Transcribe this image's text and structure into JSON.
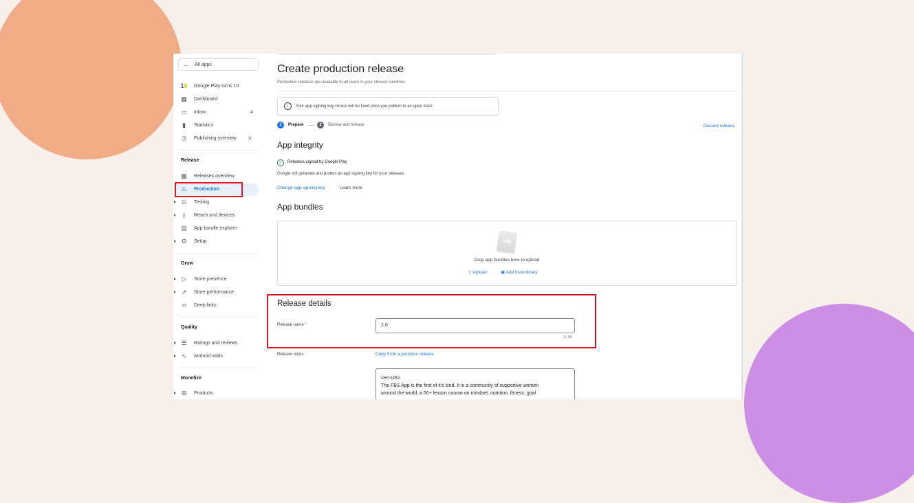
{
  "sidebar": {
    "all_apps": "All apps",
    "top_items": [
      {
        "label": "Google Play turns 10",
        "icon": "google-play-10-icon"
      },
      {
        "label": "Dashboard",
        "icon": "dashboard-icon"
      },
      {
        "label": "Inbox",
        "icon": "inbox-icon",
        "count": "4"
      },
      {
        "label": "Statistics",
        "icon": "statistics-icon"
      },
      {
        "label": "Publishing overview",
        "icon": "publishing-icon"
      }
    ],
    "sections": {
      "release": "Release",
      "grow": "Grow",
      "quality": "Quality",
      "monetize": "Monetize"
    },
    "release_items": [
      "Releases overview",
      "Production",
      "Testing",
      "Reach and devices",
      "App bundle explorer",
      "Setup"
    ],
    "grow_items": [
      "Store presence",
      "Store performance",
      "Deep links"
    ],
    "quality_items": [
      "Ratings and reviews",
      "Android vitals"
    ],
    "monetize_items": [
      "Products"
    ]
  },
  "main": {
    "title": "Create production release",
    "subtitle": "Production releases are available to all users in your chosen countries",
    "banner": "Your app signing key choice will be fixed once you publish to an open track",
    "steps": [
      {
        "num": "1",
        "label": "Prepare"
      },
      {
        "num": "2",
        "label": "Review and release"
      }
    ],
    "discard": "Discard release",
    "integrity": {
      "title": "App integrity",
      "signed": "Releases signed by Google Play",
      "desc": "Google will generate and protect an app signing key for your releases",
      "change_link": "Change app signing key",
      "learn_more": "Learn more"
    },
    "bundles": {
      "title": "App bundles",
      "aab": "AAB",
      "drop_text": "Drop app bundles here to upload",
      "upload": "Upload",
      "library": "Add from library"
    },
    "details": {
      "title": "Release details",
      "name_label": "Release name",
      "required": "*",
      "name_value": "1.0",
      "counter": "3 / 50",
      "notes_label": "Release notes",
      "copy_link": "Copy from a previous release",
      "notes_value": "<en-US>\nThe FBS App is the first of it's kind. It is a community of supportive women\naround the world, a 50+ lesson course on mindset, nutrition, fitness, goal"
    }
  },
  "colors": {
    "accent": "#1a73e8",
    "highlight_border": "#e3141b",
    "background": "#f7efe9",
    "blob_orange": "#f0ac86",
    "blob_purple": "#cd8ee6"
  }
}
